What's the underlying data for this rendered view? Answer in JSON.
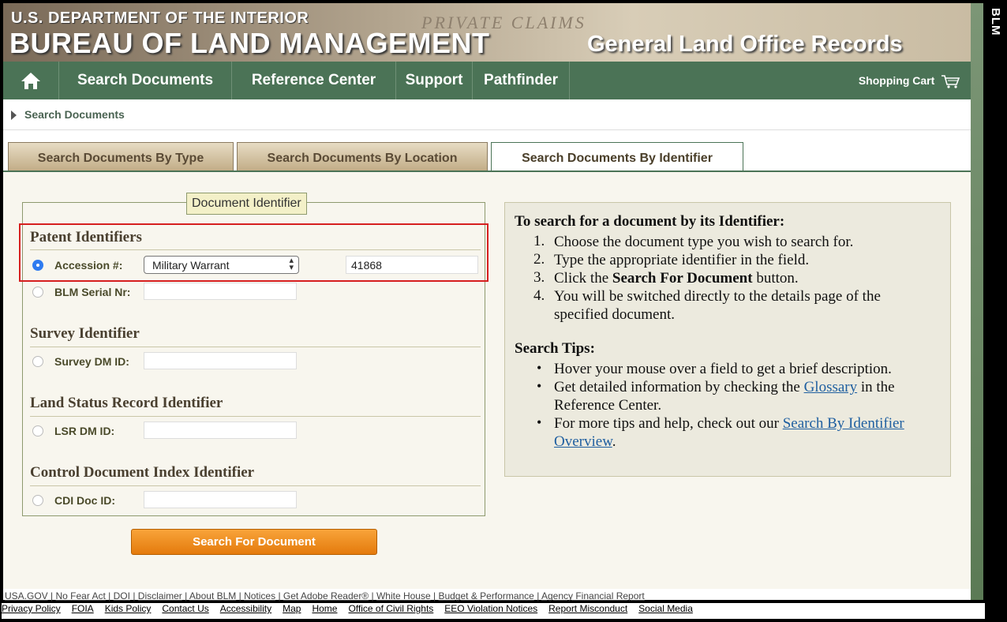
{
  "header": {
    "dept": "U.S. DEPARTMENT OF THE INTERIOR",
    "bureau": "BUREAU OF LAND MANAGEMENT",
    "subtitle": "General Land Office Records",
    "script_text": "PRIVATE CLAIMS",
    "side_label": "BLM"
  },
  "nav": {
    "home_icon": "home-icon",
    "items": [
      "Search Documents",
      "Reference Center",
      "Support",
      "Pathfinder"
    ],
    "cart_label": "Shopping Cart"
  },
  "breadcrumb": {
    "label": "Search Documents"
  },
  "tabs": [
    "Search Documents By Type",
    "Search Documents By Location",
    "Search Documents By Identifier"
  ],
  "form": {
    "legend": "Document Identifier",
    "patent_title": "Patent Identifiers",
    "accession_label": "Accession #:",
    "accession_type": "Military Warrant",
    "accession_value": "41868",
    "serial_label": "BLM Serial Nr:",
    "survey_title": "Survey Identifier",
    "survey_label": "Survey DM ID:",
    "lsr_title": "Land Status Record Identifier",
    "lsr_label": "LSR DM ID:",
    "cdi_title": "Control Document Index Identifier",
    "cdi_label": "CDI Doc ID:",
    "search_button": "Search For Document"
  },
  "help": {
    "heading": "To search for a document by its Identifier:",
    "steps": [
      "Choose the document type you wish to search for.",
      "Type the appropriate identifier in the field.",
      "button.",
      "You will be switched directly to the details page of the",
      "specified document."
    ],
    "step3_prefix": "Click the",
    "step3_bold": "Search For Document",
    "tips_heading": "Search Tips:",
    "tip1": "Hover your mouse over a field to get a brief description.",
    "tip2_prefix": "Get detailed information by checking the",
    "tip2_link": "Glossary",
    "tip2_suffix": "in the",
    "tip2_line2": "Reference Center.",
    "tip3_prefix": "For more tips and help, check out our",
    "tip3_link": "Search By Identifier",
    "tip3_link2": "Overview"
  },
  "footer": {
    "row1": [
      "USA.GOV",
      "No Fear Act",
      "DOI",
      "Disclaimer",
      "About BLM",
      "Notices",
      "Get Adobe Reader®",
      "White House",
      "Budget & Performance",
      "Agency Financial Report"
    ],
    "row2": [
      "Privacy Policy",
      "FOIA",
      "Kids Policy",
      "Contact Us",
      "Accessibility",
      "Map",
      "Home",
      "Office of Civil Rights",
      "EEO Violation Notices",
      "Report Misconduct",
      "Social Media"
    ]
  }
}
